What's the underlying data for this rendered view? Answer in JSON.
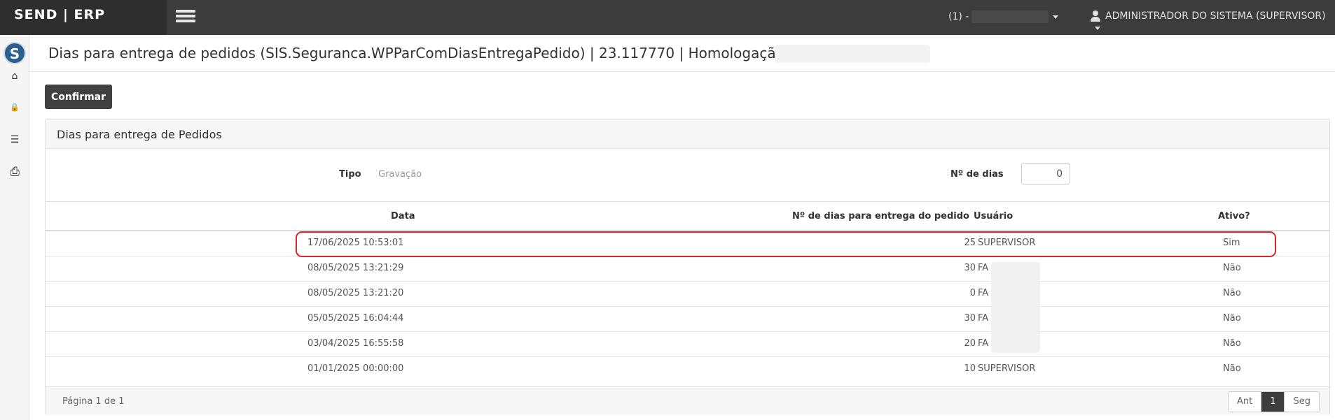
{
  "app": {
    "brand": "SEND | ERP"
  },
  "topbar": {
    "company_prefix": "(1) -",
    "user_label": "ADMINISTRADOR DO SISTEMA (SUPERVISOR)"
  },
  "sidebar": {
    "logo_letter": "S",
    "items": [
      {
        "name": "home",
        "glyph": "⌂"
      },
      {
        "name": "lock",
        "glyph": "🔒"
      },
      {
        "name": "tasks",
        "glyph": "☰"
      },
      {
        "name": "print",
        "glyph": "⎙"
      }
    ]
  },
  "page": {
    "title": "Dias para entrega de pedidos (SIS.Seguranca.WPParComDiasEntregaPedido) | 23.117770 | Homologação |"
  },
  "toolbar": {
    "confirm_label": "Confirmar"
  },
  "panel": {
    "title": "Dias para entrega de Pedidos",
    "tipo_label": "Tipo",
    "tipo_value": "Gravação",
    "dias_label": "Nº de dias",
    "dias_value": "0"
  },
  "table": {
    "headers": {
      "data": "Data",
      "dias": "Nº de dias para entrega do pedido",
      "usuario": "Usuário",
      "ativo": "Ativo?"
    },
    "rows": [
      {
        "data": "17/06/2025 10:53:01",
        "dias": "25",
        "usuario": "SUPERVISOR",
        "ativo": "Sim"
      },
      {
        "data": "08/05/2025 13:21:29",
        "dias": "30",
        "usuario": "FA",
        "ativo": "Não"
      },
      {
        "data": "08/05/2025 13:21:20",
        "dias": "0",
        "usuario": "FA",
        "ativo": "Não"
      },
      {
        "data": "05/05/2025 16:04:44",
        "dias": "30",
        "usuario": "FA",
        "ativo": "Não"
      },
      {
        "data": "03/04/2025 16:55:58",
        "dias": "20",
        "usuario": "FA",
        "ativo": "Não"
      },
      {
        "data": "01/01/2025 00:00:00",
        "dias": "10",
        "usuario": "SUPERVISOR",
        "ativo": "Não"
      }
    ]
  },
  "footer": {
    "page_info": "Página 1 de 1",
    "prev_label": "Ant",
    "current_page": "1",
    "next_label": "Seg"
  },
  "colors": {
    "topbar": "#3c3c3c",
    "highlight": "#e0232a",
    "button": "#404040"
  }
}
